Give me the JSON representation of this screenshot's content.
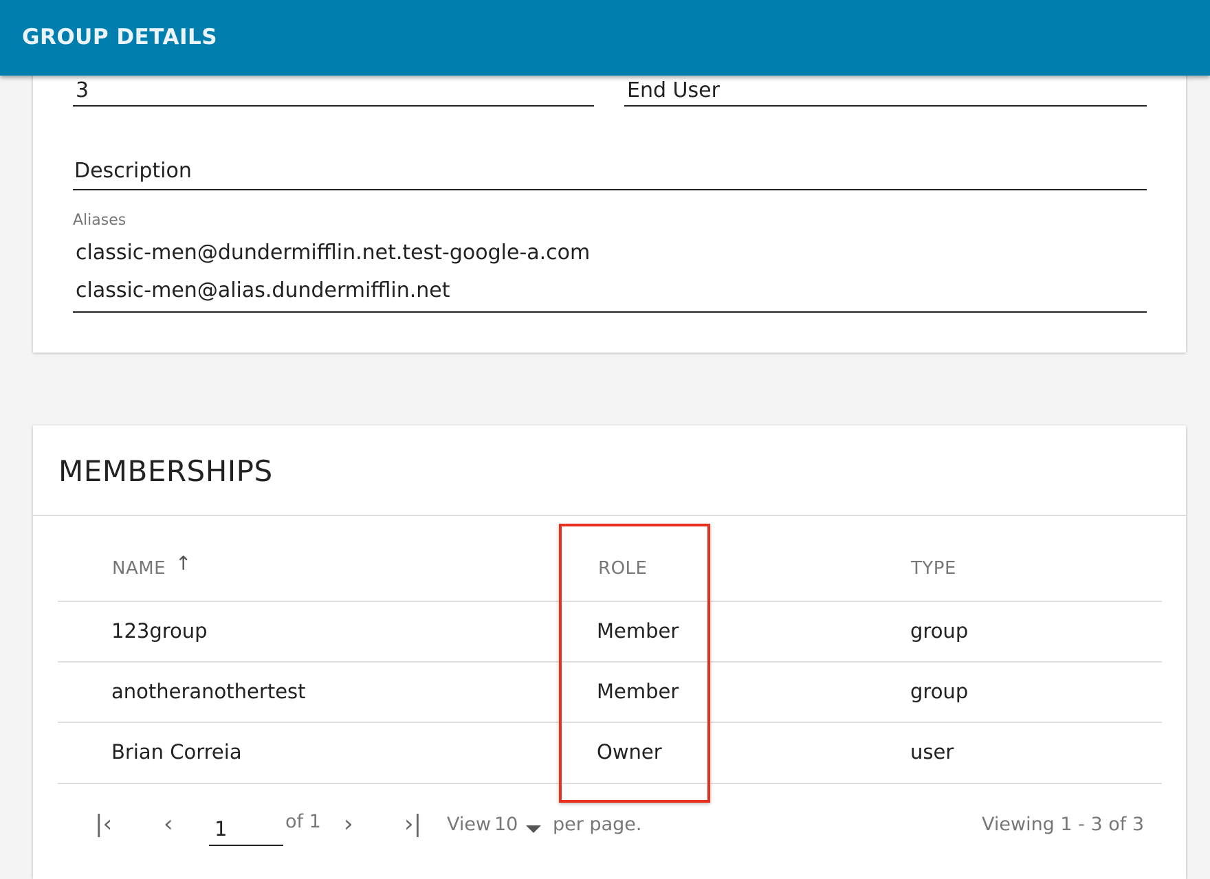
{
  "header": {
    "title": "GROUP DETAILS"
  },
  "details": {
    "field_left_value": "3",
    "field_right_value": "End User",
    "description_label": "Description",
    "aliases_label": "Aliases",
    "aliases": [
      "classic-men@dundermifflin.net.test-google-a.com",
      "classic-men@alias.dundermifflin.net"
    ]
  },
  "memberships": {
    "title": "MEMBERSHIPS",
    "columns": {
      "name": "NAME",
      "role": "ROLE",
      "type": "TYPE"
    },
    "sort_icon": "arrow-up-icon",
    "rows": [
      {
        "name": "123group",
        "role": "Member",
        "type": "group"
      },
      {
        "name": "anotheranothertest",
        "role": "Member",
        "type": "group"
      },
      {
        "name": "Brian Correia",
        "role": "Owner",
        "type": "user"
      }
    ],
    "highlight_color": "#e8301c"
  },
  "pagination": {
    "first_icon": "first-page-icon",
    "prev_icon": "chevron-left-icon",
    "next_icon": "chevron-right-icon",
    "last_icon": "last-page-icon",
    "current_page": "1",
    "of_label": "of 1",
    "view_label": "View",
    "per_page_value": "10",
    "per_page_label": "per page.",
    "viewing_label": "Viewing 1 - 3 of 3"
  },
  "colors": {
    "header": "#007ead",
    "background": "#f4f4f4"
  }
}
